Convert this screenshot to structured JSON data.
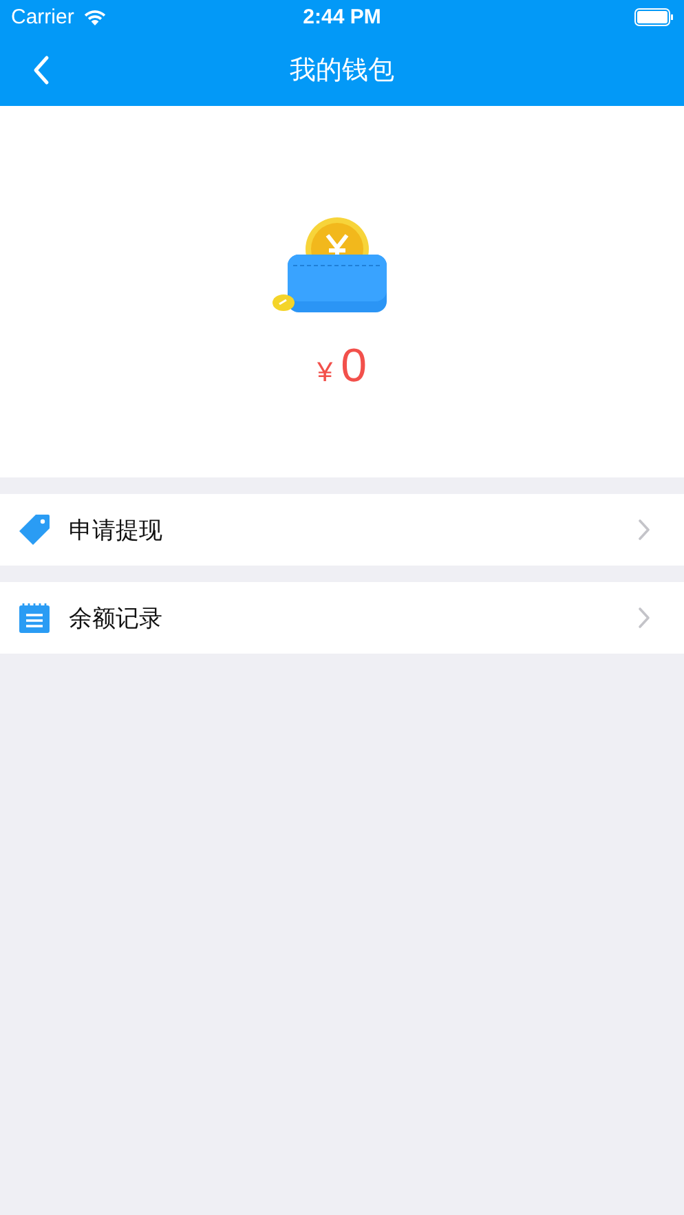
{
  "status_bar": {
    "carrier": "Carrier",
    "time": "2:44 PM"
  },
  "nav": {
    "title": "我的钱包"
  },
  "wallet": {
    "currency": "¥",
    "balance": "0"
  },
  "menu": [
    {
      "kind": "tag",
      "label": "申请提现"
    },
    {
      "kind": "calendar",
      "label": "余额记录"
    }
  ]
}
